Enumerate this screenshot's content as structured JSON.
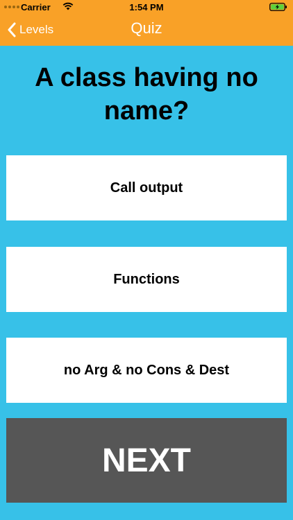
{
  "status_bar": {
    "carrier": "Carrier",
    "time": "1:54 PM",
    "battery_color": "#5dd13c"
  },
  "nav": {
    "back_label": "Levels",
    "title": "Quiz"
  },
  "question": {
    "text": "A class having no name?"
  },
  "answers": [
    {
      "label": "Call output"
    },
    {
      "label": "Functions"
    },
    {
      "label": "no Arg & no Cons & Dest"
    }
  ],
  "next_button": {
    "label": "NEXT"
  },
  "colors": {
    "header": "#f9a127",
    "background": "#37c1e8",
    "next_button": "#565656"
  }
}
